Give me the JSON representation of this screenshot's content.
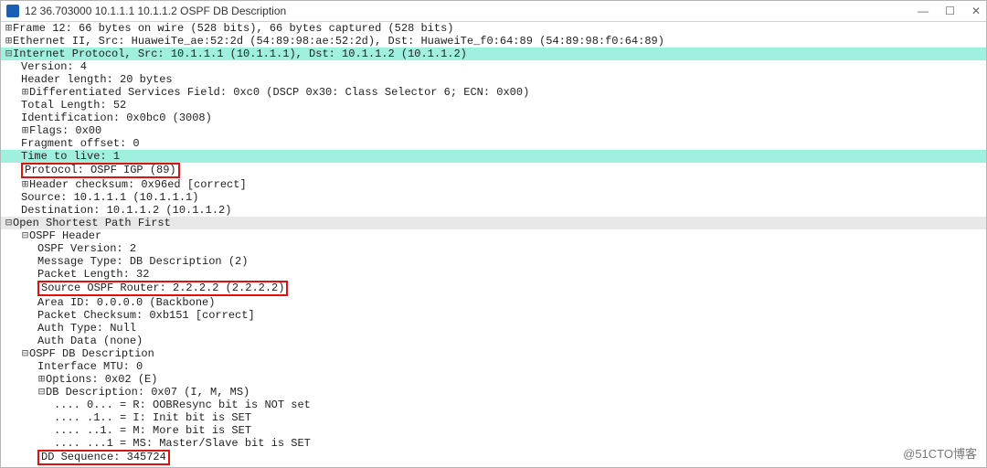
{
  "title": "12 36.703000 10.1.1.1 10.1.1.2 OSPF DB Description",
  "controls": {
    "min": "—",
    "max": "☐",
    "close": "✕"
  },
  "tree": {
    "frame": "Frame 12: 66 bytes on wire (528 bits), 66 bytes captured (528 bits)",
    "eth": "Ethernet II, Src: HuaweiTe_ae:52:2d (54:89:98:ae:52:2d), Dst: HuaweiTe_f0:64:89 (54:89:98:f0:64:89)",
    "ip_header": "Internet Protocol, Src: 10.1.1.1 (10.1.1.1), Dst: 10.1.1.2 (10.1.1.2)",
    "ip": {
      "version": "Version: 4",
      "hlen": "Header length: 20 bytes",
      "dscp": "Differentiated Services Field: 0xc0 (DSCP 0x30: Class Selector 6; ECN: 0x00)",
      "tlen": "Total Length: 52",
      "id": "Identification: 0x0bc0 (3008)",
      "flags": "Flags: 0x00",
      "frag": "Fragment offset: 0",
      "ttl": "Time to live: 1",
      "proto": "Protocol: OSPF IGP (89)",
      "cksum": "Header checksum: 0x96ed [correct]",
      "src": "Source: 10.1.1.1 (10.1.1.1)",
      "dst": "Destination: 10.1.1.2 (10.1.1.2)"
    },
    "ospf_title": "Open Shortest Path First",
    "ospf_header_title": "OSPF Header",
    "ospf_header": {
      "ver": "OSPF Version: 2",
      "msgtype": "Message Type: DB Description (2)",
      "pktlen": "Packet Length: 32",
      "router": "Source OSPF Router: 2.2.2.2 (2.2.2.2)",
      "area": "Area ID: 0.0.0.0 (Backbone)",
      "cksum": "Packet Checksum: 0xb151 [correct]",
      "authtype": "Auth Type: Null",
      "authdata": "Auth Data (none)"
    },
    "dbdesc_title": "OSPF DB Description",
    "dbdesc": {
      "mtu": "Interface MTU: 0",
      "options": "Options: 0x02 (E)",
      "dbdesc_val": "DB Description: 0x07 (I, M, MS)",
      "bits": {
        "r": ".... 0... = R: OOBResync bit is NOT set",
        "i": ".... .1.. = I: Init bit is SET",
        "m": ".... ..1. = M: More bit is SET",
        "ms": ".... ...1 = MS: Master/Slave bit is SET"
      },
      "seq": "DD Sequence: 345724"
    }
  },
  "watermark": "@51CTO博客",
  "carets": {
    "plus": "⊞",
    "minus": "⊟"
  }
}
